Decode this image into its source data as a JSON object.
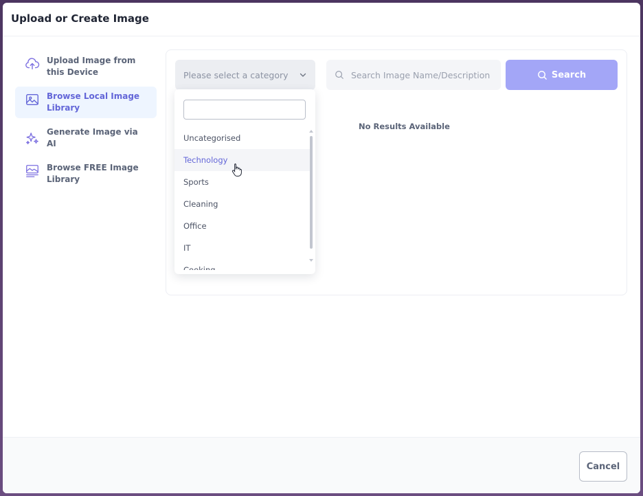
{
  "modal": {
    "title": "Upload or Create Image"
  },
  "sidebar": {
    "items": [
      {
        "label": "Upload Image from this Device",
        "icon": "cloud-upload-icon",
        "active": false
      },
      {
        "label": "Browse Local Image Library",
        "icon": "image-icon",
        "active": true
      },
      {
        "label": "Generate Image via AI",
        "icon": "sparkles-icon",
        "active": false
      },
      {
        "label": "Browse FREE Image Library",
        "icon": "image-library-icon",
        "active": false
      }
    ]
  },
  "filters": {
    "category_placeholder": "Please select a category",
    "search_placeholder": "Search Image Name/Description",
    "search_button_label": "Search"
  },
  "results": {
    "empty_message": "No Results Available"
  },
  "dropdown": {
    "search_value": "",
    "options": [
      "Uncategorised",
      "Technology",
      "Sports",
      "Cleaning",
      "Office",
      "IT",
      "Cooking"
    ],
    "hovered_option": "Technology"
  },
  "footer": {
    "cancel_label": "Cancel"
  },
  "colors": {
    "accent": "#6366d8",
    "search_button": "#a3a6f7",
    "active_bg": "#eef5ff"
  }
}
